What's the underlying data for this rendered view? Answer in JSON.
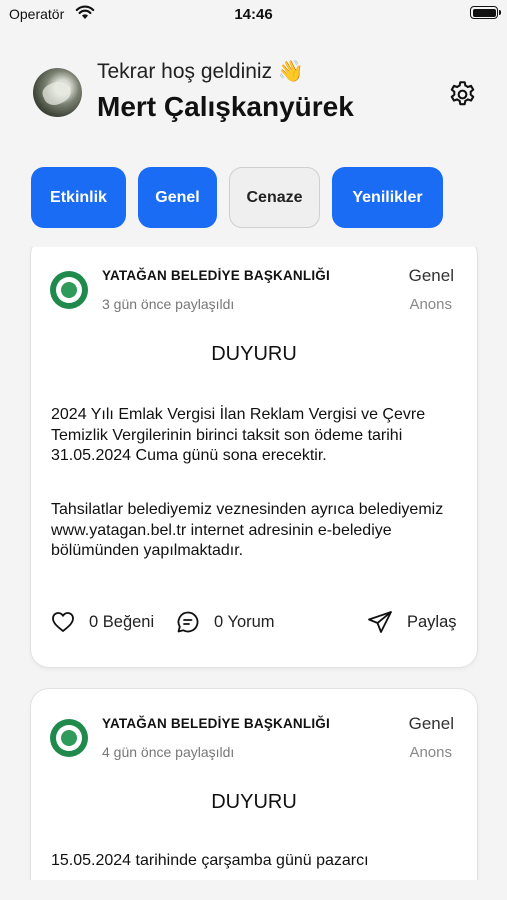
{
  "status_bar": {
    "carrier": "Operatör",
    "time": "14:46"
  },
  "header": {
    "greeting": "Tekrar hoş geldiniz 👋",
    "user_name": "Mert Çalışkanyürek"
  },
  "tabs": [
    {
      "label": "Etkinlik",
      "active": true
    },
    {
      "label": "Genel",
      "active": true
    },
    {
      "label": "Cenaze",
      "active": false
    },
    {
      "label": "Yenilikler",
      "active": true
    }
  ],
  "colors": {
    "accent": "#1a6cf5",
    "logo_green": "#1f8a4c"
  },
  "posts": [
    {
      "organization": "YATAĞAN BELEDİYE BAŞKANLIĞI",
      "time_ago": "3 gün önce paylaşıldı",
      "category": "Genel",
      "type": "Anons",
      "title": "DUYURU",
      "paragraphs": [
        "2024 Yılı Emlak Vergisi İlan Reklam Vergisi ve Çevre Temizlik Vergilerinin birinci taksit son ödeme tarihi 31.05.2024 Cuma günü sona erecektir.",
        "Tahsilatlar belediyemiz veznesinden ayrıca belediyemiz www.yatagan.bel.tr internet adresinin e-belediye bölümünden yapılmaktadır."
      ],
      "likes": "0 Beğeni",
      "comments": "0 Yorum",
      "share": "Paylaş"
    },
    {
      "organization": "YATAĞAN BELEDİYE BAŞKANLIĞI",
      "time_ago": "4 gün önce paylaşıldı",
      "category": "Genel",
      "type": "Anons",
      "title": "DUYURU",
      "paragraphs": [
        "15.05.2024 tarihinde çarşamba günü pazarcı"
      ]
    }
  ]
}
